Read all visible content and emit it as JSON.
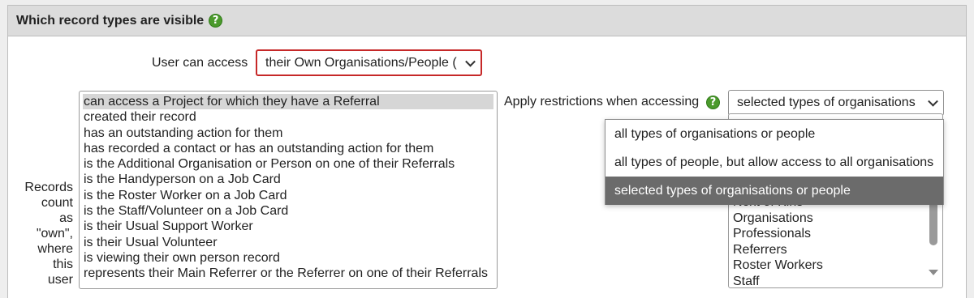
{
  "section": {
    "title": "Which record types are visible",
    "help_glyph": "?"
  },
  "access": {
    "label": "User can access",
    "selected": "their Own Organisations/People (",
    "accent_color": "#c62828"
  },
  "records": {
    "label_lines": [
      "Records",
      "count",
      "as",
      "\"own\",",
      "where",
      "this",
      "user"
    ],
    "options": [
      {
        "label": "can access a Project for which they have a Referral",
        "selected": true
      },
      {
        "label": "created their record",
        "selected": false
      },
      {
        "label": "has an outstanding action for them",
        "selected": false
      },
      {
        "label": "has recorded a contact or has an outstanding action for them",
        "selected": false
      },
      {
        "label": "is the Additional Organisation or Person on one of their Referrals",
        "selected": false
      },
      {
        "label": "is the Handyperson on a Job Card",
        "selected": false
      },
      {
        "label": "is the Roster Worker on a Job Card",
        "selected": false
      },
      {
        "label": "is the Staff/Volunteer on a Job Card",
        "selected": false
      },
      {
        "label": "is their Usual Support Worker",
        "selected": false
      },
      {
        "label": "is their Usual Volunteer",
        "selected": false
      },
      {
        "label": "is viewing their own person record",
        "selected": false
      },
      {
        "label": "represents their Main Referrer or the Referrer on one of their Referrals",
        "selected": false
      }
    ]
  },
  "restrictions": {
    "label": "Apply restrictions when accessing",
    "selected": "selected types of organisations",
    "dropdown_options": [
      {
        "label": "all types of organisations or people",
        "highlighted": false
      },
      {
        "label": "all types of people, but allow access to all organisations",
        "highlighted": false
      },
      {
        "label": "selected types of organisations or people",
        "highlighted": true
      }
    ],
    "type_options": [
      "Next of Kins",
      "Organisations",
      "Professionals",
      "Referrers",
      "Roster Workers",
      "Staff"
    ]
  }
}
